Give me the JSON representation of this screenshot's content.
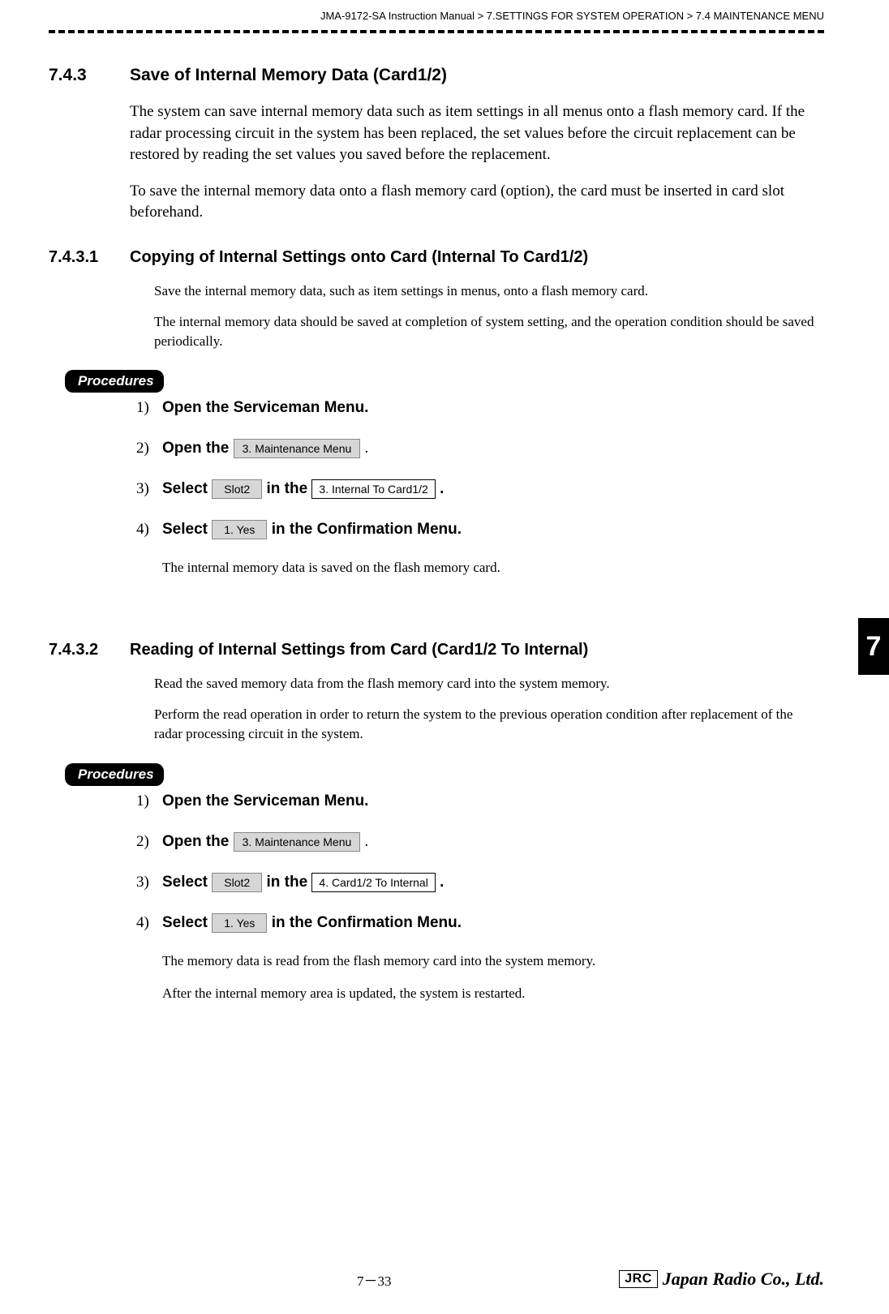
{
  "header": {
    "breadcrumb": "JMA-9172-SA Instruction Manual > 7.SETTINGS FOR SYSTEM OPERATION > 7.4  MAINTENANCE MENU"
  },
  "section743": {
    "num": "7.4.3",
    "title": "Save of Internal Memory Data (Card1/2)",
    "p1": "The system can save internal memory data such as item settings in all menus onto a flash memory card. If the radar processing circuit in the system has been replaced, the set values before the circuit replacement can be restored by reading the set values you saved before the replacement.",
    "p2": "To save the internal memory data onto a flash memory card (option), the card must be inserted in card slot beforehand."
  },
  "section7431": {
    "num": "7.4.3.1",
    "title": "Copying of Internal Settings onto Card (Internal To Card1/2)",
    "p1": "Save the internal memory data, such as item settings in menus, onto a flash memory card.",
    "p2": "The internal memory data should be saved at completion of system setting, and the operation condition should be saved periodically.",
    "proc_label": "Procedures",
    "steps": {
      "s1_num": "1)",
      "s1_text": "Open the Serviceman Menu.",
      "s2_num": "2)",
      "s2_pre": "Open the ",
      "s2_btn": "3. Maintenance Menu",
      "s2_post": " .",
      "s3_num": "3)",
      "s3_pre": "Select ",
      "s3_btn1": "Slot2",
      "s3_mid": " in the ",
      "s3_btn2": "3. Internal To Card1/2",
      "s3_post": " .",
      "s4_num": "4)",
      "s4_pre": "Select ",
      "s4_btn": "1. Yes",
      "s4_post": " in the Confirmation Menu."
    },
    "note": "The internal memory data is saved on the flash memory card."
  },
  "section7432": {
    "num": "7.4.3.2",
    "title": "Reading of Internal Settings from Card (Card1/2 To Internal)",
    "p1": "Read the saved memory data from the flash memory card into the system memory.",
    "p2": "Perform the read operation in order to return the system to the previous operation condition after replacement of the radar processing circuit in the system.",
    "proc_label": "Procedures",
    "steps": {
      "s1_num": "1)",
      "s1_text": "Open the Serviceman Menu.",
      "s2_num": "2)",
      "s2_pre": "Open the ",
      "s2_btn": "3. Maintenance Menu",
      "s2_post": " .",
      "s3_num": "3)",
      "s3_pre": "Select ",
      "s3_btn1": "Slot2",
      "s3_mid": " in the ",
      "s3_btn2": "4. Card1/2 To Internal",
      "s3_post": " .",
      "s4_num": "4)",
      "s4_pre": "Select ",
      "s4_btn": "1. Yes",
      "s4_post": " in the Confirmation Menu."
    },
    "note1": "The memory data is read from the flash memory card into the system memory.",
    "note2": "After the internal memory area is updated, the system is restarted."
  },
  "side_tab": "7",
  "footer": {
    "page": "7－33",
    "logo_box": "JRC",
    "logo_script": "Japan Radio Co., Ltd."
  }
}
